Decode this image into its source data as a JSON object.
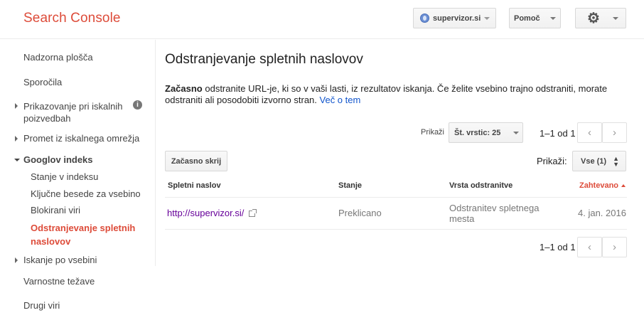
{
  "app": {
    "title": "Search Console"
  },
  "header": {
    "site": "supervizor.si",
    "help": "Pomoč"
  },
  "sidebar": {
    "items": [
      {
        "label": "Nadzorna plošča"
      },
      {
        "label": "Sporočila"
      },
      {
        "label": "Prikazovanje pri iskalnih poizvedbah"
      },
      {
        "label": "Promet iz iskalnega omrežja"
      },
      {
        "label": "Googlov indeks"
      },
      {
        "label": "Stanje v indeksu"
      },
      {
        "label": "Ključne besede za vsebino"
      },
      {
        "label": "Blokirani viri"
      },
      {
        "label": "Odstranjevanje spletnih naslovov"
      },
      {
        "label": "Iskanje po vsebini"
      },
      {
        "label": "Varnostne težave"
      },
      {
        "label": "Drugi viri"
      }
    ]
  },
  "main": {
    "title": "Odstranjevanje spletnih naslovov",
    "desc_bold": "Začasno",
    "desc_text": " odstranite URL-je, ki so v vaši lasti, iz rezultatov iskanja. Če želite vsebino trajno odstraniti, morate odstraniti ali posodobiti izvorno stran. ",
    "desc_link": "Več o tem",
    "show_label": "Prikaži",
    "rows_select": "Št. vrstic: 25",
    "pager": "1–1 od 1",
    "hide_button": "Začasno skrij",
    "show_label2": "Prikaži:",
    "filter_select": "Vse (1)",
    "columns": [
      "Spletni naslov",
      "Stanje",
      "Vrsta odstranitve",
      "Zahtevano"
    ],
    "rows": [
      {
        "url": "http://supervizor.si/",
        "status": "Preklicano",
        "type": "Odstranitev spletnega mesta",
        "date": "4. jan. 2016"
      }
    ]
  },
  "colors": {
    "brand": "#dd4b39",
    "link": "#1155cc",
    "visited": "#660099"
  }
}
